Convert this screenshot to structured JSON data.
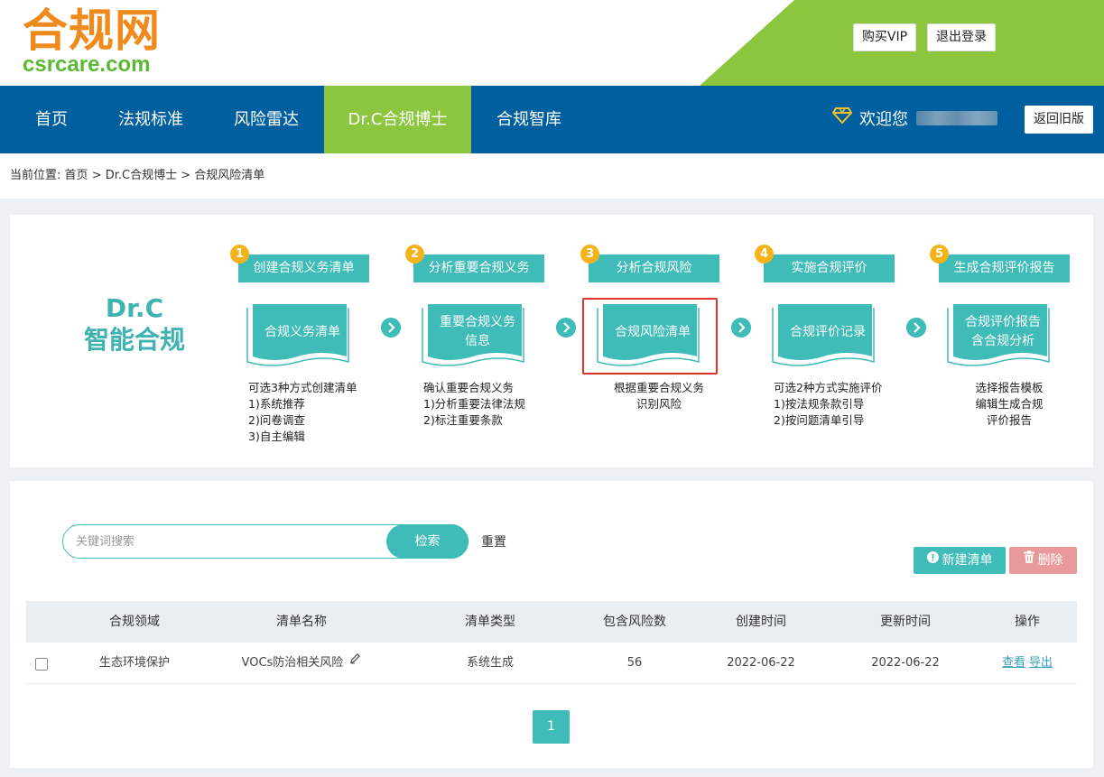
{
  "header": {
    "logo_cn": "合规网",
    "logo_en": "csrcare.com",
    "buy_vip": "购买VIP",
    "logout": "退出登录"
  },
  "nav": {
    "items": [
      {
        "label": "首页"
      },
      {
        "label": "法规标准"
      },
      {
        "label": "风险雷达"
      },
      {
        "label": "Dr.C合规博士",
        "active": true
      },
      {
        "label": "合规智库"
      }
    ],
    "welcome": "欢迎您",
    "old_version": "返回旧版"
  },
  "breadcrumb": {
    "prefix": "当前位置:",
    "path": [
      "首页",
      "Dr.C合规博士",
      "合规风险清单"
    ],
    "sep": ">"
  },
  "brand": {
    "line1": "Dr.C",
    "line2": "智能合规"
  },
  "steps": [
    {
      "num": "1",
      "head": "创建合规义务清单",
      "doc": [
        "合规义务清单"
      ],
      "desc": [
        "可选3种方式创建清单",
        "1)系统推荐",
        "2)问卷调查",
        "3)自主编辑"
      ]
    },
    {
      "num": "2",
      "head": "分析重要合规义务",
      "doc": [
        "重要合规义务",
        "信息"
      ],
      "desc": [
        "确认重要合规义务",
        "1)分析重要法律法规",
        "2)标注重要条款"
      ]
    },
    {
      "num": "3",
      "head": "分析合规风险",
      "doc": [
        "合规风险清单"
      ],
      "desc": [
        "根据重要合规义务",
        "识别风险"
      ]
    },
    {
      "num": "4",
      "head": "实施合规评价",
      "doc": [
        "合规评价记录"
      ],
      "desc": [
        "可选2种方式实施评价",
        "1)按法规条款引导",
        "2)按问题清单引导"
      ]
    },
    {
      "num": "5",
      "head": "生成合规评价报告",
      "doc": [
        "合规评价报告",
        "含合规分析"
      ],
      "desc": [
        "选择报告模板",
        "编辑生成合规",
        "评价报告"
      ]
    }
  ],
  "search": {
    "placeholder": "关键词搜索",
    "button": "检索",
    "reset": "重置"
  },
  "actions": {
    "new": "新建清单",
    "delete": "删除"
  },
  "table": {
    "columns": [
      "合规领域",
      "清单名称",
      "清单类型",
      "包含风险数",
      "创建时间",
      "更新时间",
      "操作"
    ],
    "rows": [
      {
        "domain": "生态环境保护",
        "name": "VOCs防治相关风险",
        "type": "系统生成",
        "risks": "56",
        "created": "2022-06-22",
        "updated": "2022-06-22",
        "view": "查看",
        "export": "导出"
      }
    ]
  },
  "pagination": {
    "current": "1"
  },
  "colors": {
    "nav_bg": "#005f9e",
    "active_green": "#8cc63f",
    "teal": "#3fbcb8",
    "logo_orange": "#f08a1c",
    "logo_green": "#5bb833",
    "danger_soft": "#e89a9a",
    "highlight_red": "#e0322d"
  }
}
